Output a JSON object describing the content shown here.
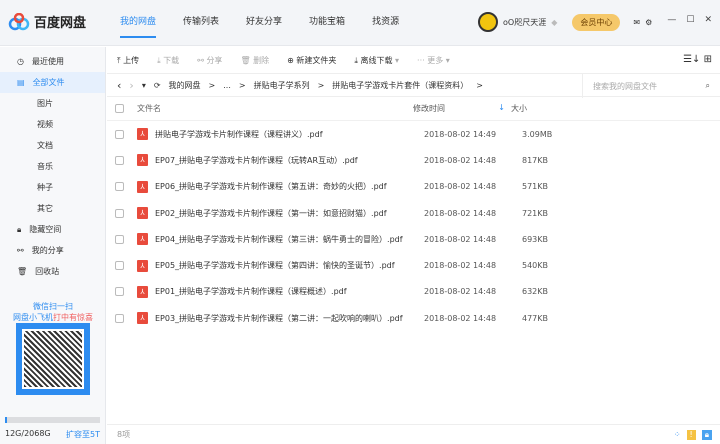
{
  "app": {
    "title": "百度网盘"
  },
  "nav": [
    {
      "label": "我的网盘"
    },
    {
      "label": "传输列表"
    },
    {
      "label": "好友分享"
    },
    {
      "label": "功能宝箱"
    },
    {
      "label": "找资源"
    }
  ],
  "user": {
    "name": "oO咫尺天涯",
    "vip_label": "会员中心"
  },
  "sidebar": {
    "items": [
      {
        "label": "最近使用"
      },
      {
        "label": "全部文件"
      },
      {
        "label": "图片"
      },
      {
        "label": "视频"
      },
      {
        "label": "文档"
      },
      {
        "label": "音乐"
      },
      {
        "label": "种子"
      },
      {
        "label": "其它"
      },
      {
        "label": "隐藏空间"
      },
      {
        "label": "我的分享"
      },
      {
        "label": "回收站"
      }
    ],
    "promo_line1": "微信扫一扫",
    "promo_line2a": "网盘小飞机",
    "promo_line2b": "打中有惊喜",
    "storage": {
      "text": "12G/2068G",
      "used_fraction": 0.006,
      "expand": "扩容至5T"
    }
  },
  "toolbar": {
    "upload": "上传",
    "download": "下载",
    "share": "分享",
    "delete": "删除",
    "new_folder": "新建文件夹",
    "offline": "离线下载",
    "more": "更多"
  },
  "breadcrumb": {
    "items": [
      "我的网盘",
      "...",
      "拼贴电子学系列",
      "拼贴电子学游戏卡片套件（课程资料）"
    ]
  },
  "search": {
    "placeholder": "搜索我的网盘文件"
  },
  "table": {
    "headers": {
      "name": "文件名",
      "time": "修改时间",
      "size": "大小"
    },
    "rows": [
      {
        "name": "拼贴电子学游戏卡片制作课程（课程讲义）.pdf",
        "time": "2018-08-02 14:49",
        "size": "3.09MB"
      },
      {
        "name": "EP07_拼贴电子学游戏卡片制作课程（玩转AR互动）.pdf",
        "time": "2018-08-02 14:48",
        "size": "817KB"
      },
      {
        "name": "EP06_拼贴电子学游戏卡片制作课程（第五讲：奇妙的火把）.pdf",
        "time": "2018-08-02 14:48",
        "size": "571KB"
      },
      {
        "name": "EP02_拼贴电子学游戏卡片制作课程（第一讲：如意招财猫）.pdf",
        "time": "2018-08-02 14:48",
        "size": "721KB"
      },
      {
        "name": "EP04_拼贴电子学游戏卡片制作课程（第三讲：蜗牛勇士的冒险）.pdf",
        "time": "2018-08-02 14:48",
        "size": "693KB"
      },
      {
        "name": "EP05_拼贴电子学游戏卡片制作课程（第四讲：愉快的圣诞节）.pdf",
        "time": "2018-08-02 14:48",
        "size": "540KB"
      },
      {
        "name": "EP01_拼贴电子学游戏卡片制作课程（课程概述）.pdf",
        "time": "2018-08-02 14:48",
        "size": "632KB"
      },
      {
        "name": "EP03_拼贴电子学游戏卡片制作课程（第二讲：一起吹响的喇叭）.pdf",
        "time": "2018-08-02 14:48",
        "size": "477KB"
      }
    ]
  },
  "footer": {
    "count": "8项"
  }
}
